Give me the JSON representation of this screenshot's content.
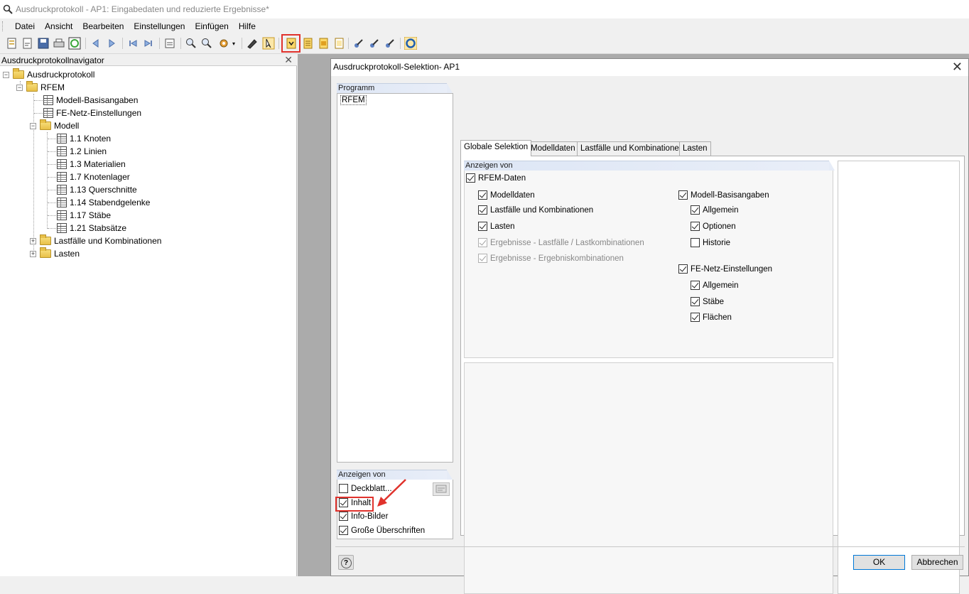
{
  "window": {
    "title": "Ausdruckprotokoll - AP1: Eingabedaten und reduzierte Ergebnisse*"
  },
  "menu": [
    "Datei",
    "Ansicht",
    "Bearbeiten",
    "Einstellungen",
    "Einfügen",
    "Hilfe"
  ],
  "navigator": {
    "title": "Ausdruckprotokollnavigator",
    "close": "✕",
    "tree": {
      "root": "Ausdruckprotokoll",
      "rfem": "RFEM",
      "modell_basis": "Modell-Basisangaben",
      "fe_netz": "FE-Netz-Einstellungen",
      "modell": "Modell",
      "modell_items": [
        "1.1 Knoten",
        "1.2 Linien",
        "1.3 Materialien",
        "1.7 Knotenlager",
        "1.13 Querschnitte",
        "1.14 Stabendgelenke",
        "1.17 Stäbe",
        "1.21 Stabsätze"
      ],
      "lastfaelle": "Lastfälle und Kombinationen",
      "lasten": "Lasten"
    }
  },
  "dialog": {
    "title": "Ausdruckprotokoll-Selektion- AP1",
    "close": "✕",
    "programm": {
      "header": "Programm",
      "items": [
        "RFEM"
      ]
    },
    "anzeigen_left": {
      "header": "Anzeigen von",
      "items": [
        {
          "label": "Deckblatt...",
          "checked": false
        },
        {
          "label": "Inhalt",
          "checked": true
        },
        {
          "label": "Info-Bilder",
          "checked": true
        },
        {
          "label": "Große Überschriften",
          "checked": true
        }
      ]
    },
    "tabs": [
      "Globale Selektion",
      "Modelldaten",
      "Lastfälle und Kombinationen",
      "Lasten"
    ],
    "global": {
      "header": "Anzeigen von",
      "rfem_daten": "RFEM-Daten",
      "left": [
        {
          "label": "Modelldaten",
          "checked": true,
          "disabled": false
        },
        {
          "label": "Lastfälle und Kombinationen",
          "checked": true,
          "disabled": false
        },
        {
          "label": "Lasten",
          "checked": true,
          "disabled": false
        },
        {
          "label": "Ergebnisse - Lastfälle / Lastkombinationen",
          "checked": true,
          "disabled": true
        },
        {
          "label": "Ergebnisse - Ergebniskombinationen",
          "checked": true,
          "disabled": true
        }
      ],
      "basis": {
        "label": "Modell-Basisangaben",
        "items": [
          "Allgemein",
          "Optionen",
          "Historie"
        ],
        "checked": [
          true,
          true,
          false
        ]
      },
      "fe": {
        "label": "FE-Netz-Einstellungen",
        "items": [
          "Allgemein",
          "Stäbe",
          "Flächen"
        ],
        "checked": [
          true,
          true,
          true
        ]
      }
    },
    "buttons": {
      "help": "?",
      "ok": "OK",
      "cancel": "Abbrechen"
    }
  },
  "colors": {
    "highlight": "#e0322c",
    "panel_header": "#dde6f5",
    "accent": "#0078d7"
  }
}
